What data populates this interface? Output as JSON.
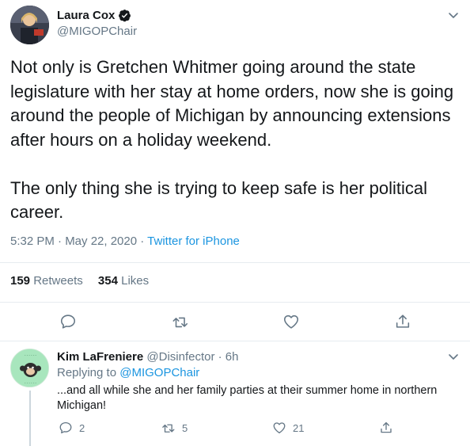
{
  "tweet": {
    "author_name": "Laura Cox",
    "handle": "@MIGOPChair",
    "text": "Not only is Gretchen Whitmer going around the state legislature with her stay at home orders, now she is going around the people of Michigan by announcing extensions after hours on a holiday weekend.\n\nThe only thing she is trying to keep safe is her political career.",
    "time": "5:32 PM · May 22, 2020 ·",
    "source": "Twitter for iPhone",
    "retweets_count": "159",
    "retweets_label": "Retweets",
    "likes_count": "354",
    "likes_label": "Likes"
  },
  "reply": {
    "author_name": "Kim LaFreniere",
    "handle_time": "@Disinfector · 6h",
    "replying_prefix": "Replying to",
    "replying_to": "@MIGOPChair",
    "text": "...and all while she and her family parties at their summer home in northern Michigan!",
    "reply_count": "2",
    "retweet_count": "5",
    "like_count": "21"
  },
  "colors": {
    "accent": "#1b95e0",
    "secondary_text": "#657786",
    "primary_text": "#14171a",
    "border": "#e6ecf0"
  },
  "icons": [
    "verified-badge-icon",
    "chevron-down-icon",
    "reply-icon",
    "retweet-icon",
    "like-icon",
    "share-icon"
  ]
}
